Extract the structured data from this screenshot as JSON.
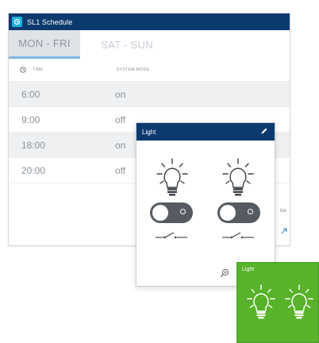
{
  "schedule": {
    "title": "SL1 Schedule",
    "tabs": [
      {
        "label": "MON - FRI",
        "active": true
      },
      {
        "label": "SAT - SUN",
        "active": false
      }
    ],
    "columns": {
      "time": "TIME",
      "mode": "SYSTEM MODE"
    },
    "rows": [
      {
        "time": "6:00",
        "mode": "on"
      },
      {
        "time": "9:00",
        "mode": "off"
      },
      {
        "time": "18:00",
        "mode": "on"
      },
      {
        "time": "20:00",
        "mode": "off"
      }
    ],
    "edge_text": "ble"
  },
  "light_panel": {
    "title": "Light",
    "edit_icon": "pencil-icon",
    "devices": [
      {
        "icon": "lightbulb-icon",
        "state": "off"
      },
      {
        "icon": "lightbulb-icon",
        "state": "off"
      }
    ],
    "zoom_icon": "zoom-in-icon"
  },
  "green_tile": {
    "title": "Light",
    "color": "#58b22a",
    "icons": [
      "lightbulb-icon",
      "lightbulb-icon"
    ]
  },
  "colors": {
    "header_navy": "#0d3a6e",
    "app_icon_cyan": "#1ab5e0",
    "tab_underline": "#7fb6e0",
    "toggle_dark": "#555b61"
  }
}
